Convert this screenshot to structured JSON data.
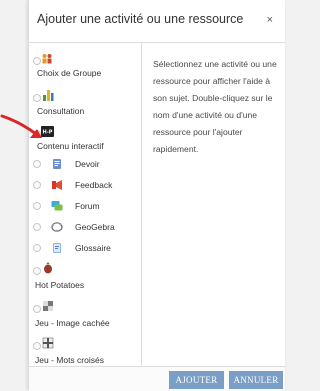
{
  "dialog": {
    "title": "Ajouter une activité ou une ressource",
    "close_label": "×"
  },
  "activities": [
    {
      "label": "Choix de Groupe",
      "icon": "group-choice-icon"
    },
    {
      "label": "Consultation",
      "icon": "poll-chart-icon"
    },
    {
      "label": "Contenu interactif",
      "icon": "h5p-icon"
    },
    {
      "label": "Devoir",
      "icon": "assignment-icon"
    },
    {
      "label": "Feedback",
      "icon": "feedback-icon"
    },
    {
      "label": "Forum",
      "icon": "forum-icon"
    },
    {
      "label": "GeoGebra",
      "icon": "geogebra-icon"
    },
    {
      "label": "Glossaire",
      "icon": "glossary-icon"
    },
    {
      "label": "Hot Potatoes",
      "icon": "hot-potatoes-icon"
    },
    {
      "label": "Jeu - Image cachée",
      "icon": "hidden-image-game-icon"
    },
    {
      "label": "Jeu - Mots croisés",
      "icon": "crossword-icon"
    }
  ],
  "help": {
    "text": "Sélectionnez une activité ou une ressource pour afficher l'aide à son sujet. Double-cliquez sur le nom d'une activité ou d'une ressource pour l'ajouter rapidement."
  },
  "footer": {
    "add_label": "AJOUTER",
    "cancel_label": "ANNULER"
  },
  "colors": {
    "button": "#7b9ec7",
    "annotation_arrow": "#d9262a"
  }
}
